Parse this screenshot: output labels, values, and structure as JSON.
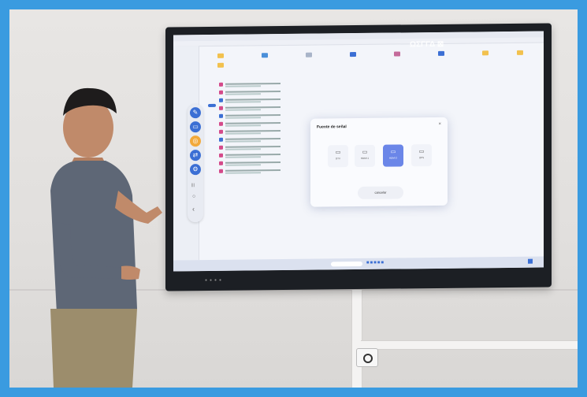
{
  "screen_ui": {
    "dialog": {
      "title": "Fuente de señal",
      "close_glyph": "×",
      "sources": [
        {
          "label": "DTV",
          "icon": "tv-icon",
          "glyph": "▭",
          "active": false
        },
        {
          "label": "HDMI 1",
          "icon": "hdmi-icon",
          "glyph": "▭",
          "active": false
        },
        {
          "label": "HDMI 2",
          "icon": "hdmi-icon",
          "glyph": "▭",
          "active": true
        },
        {
          "label": "OPS",
          "icon": "ops-icon",
          "glyph": "▭",
          "active": false
        }
      ],
      "cancel_label": "cancelar"
    },
    "watermark": "ΩΣΓΓΔ ⊠",
    "float_toolbar": {
      "buttons": [
        {
          "icon": "pen-icon",
          "glyph": "✎",
          "color": "#3b6fd4"
        },
        {
          "icon": "whiteboard-icon",
          "glyph": "▭",
          "color": "#3b6fd4"
        },
        {
          "icon": "apps-icon",
          "glyph": "◎",
          "color": "#f2a93b"
        },
        {
          "icon": "transfer-icon",
          "glyph": "⇄",
          "color": "#3b6fd4"
        },
        {
          "icon": "settings-icon",
          "glyph": "⚙",
          "color": "#3b6fd4"
        }
      ],
      "glyphs": [
        {
          "icon": "menu-icon",
          "glyph": "|||"
        },
        {
          "icon": "home-icon",
          "glyph": "○"
        },
        {
          "icon": "back-icon",
          "glyph": "‹"
        }
      ]
    }
  },
  "colors": {
    "frame": "#3a9be0",
    "accent": "#6b86e8",
    "wall": "#e3e1df",
    "bezel": "#1c1f24"
  }
}
